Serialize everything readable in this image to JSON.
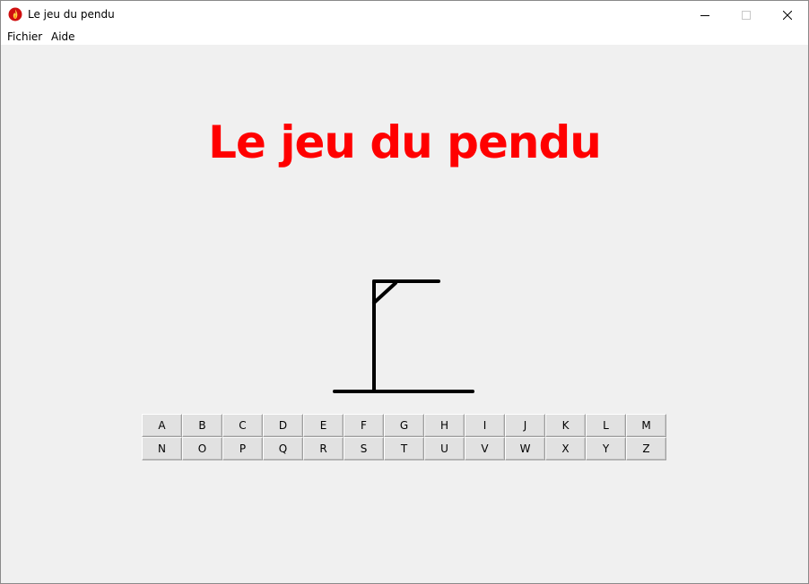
{
  "window": {
    "title": "Le jeu du pendu",
    "minimize_icon": "minimize-icon",
    "maximize_icon": "maximize-icon",
    "close_icon": "close-icon",
    "app_icon": "flame-icon"
  },
  "menu": {
    "items": [
      {
        "label": "Fichier"
      },
      {
        "label": "Aide"
      }
    ]
  },
  "game": {
    "title": "Le jeu du pendu",
    "title_color": "#ff0000",
    "word_length": 7,
    "revealed": [
      "",
      "",
      "",
      "",
      "",
      "",
      ""
    ],
    "stage": "gallows-only"
  },
  "keyboard": {
    "rows": [
      [
        "A",
        "B",
        "C",
        "D",
        "E",
        "F",
        "G",
        "H",
        "I",
        "J",
        "K",
        "L",
        "M"
      ],
      [
        "N",
        "O",
        "P",
        "Q",
        "R",
        "S",
        "T",
        "U",
        "V",
        "W",
        "X",
        "Y",
        "Z"
      ]
    ]
  }
}
